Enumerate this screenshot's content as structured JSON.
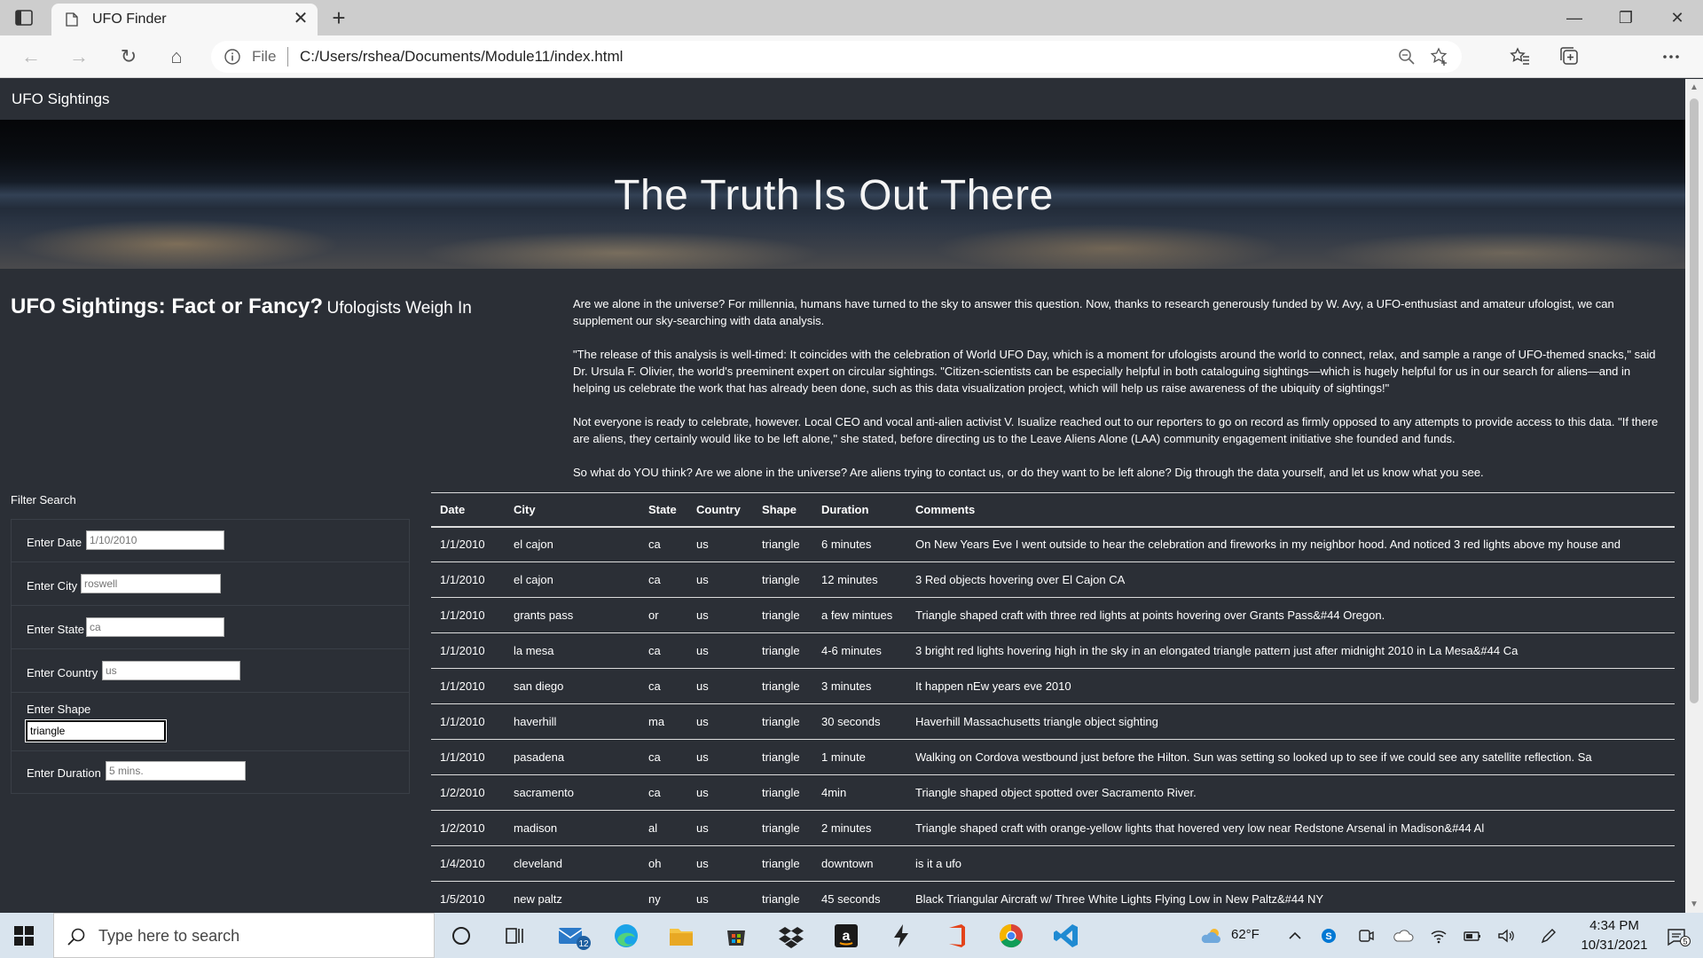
{
  "browser": {
    "tab_title": "UFO Finder",
    "address_prefix": "File",
    "url": "C:/Users/rshea/Documents/Module11/index.html"
  },
  "navbar": {
    "brand": "UFO Sightings"
  },
  "hero": {
    "title": "The Truth Is Out There"
  },
  "headline": {
    "main": "UFO Sightings: Fact or Fancy?",
    "sub": "Ufologists Weigh In"
  },
  "article": [
    "Are we alone in the universe? For millennia, humans have turned to the sky to answer this question. Now, thanks to research generously funded by W. Avy, a UFO-enthusiast and amateur ufologist, we can supplement our sky-searching with data analysis.",
    "\"The release of this analysis is well-timed: It coincides with the celebration of World UFO Day, which is a moment for ufologists around the world to connect, relax, and sample a range of UFO-themed snacks,\" said Dr. Ursula F. Olivier, the world's preeminent expert on circular sightings. \"Citizen-scientists can be especially helpful in both cataloguing sightings—which is hugely helpful for us in our search for aliens—and in helping us celebrate the work that has already been done, such as this data visualization project, which will help us raise awareness of the ubiquity of sightings!\"",
    "Not everyone is ready to celebrate, however. Local CEO and vocal anti-alien activist V. Isualize reached out to our reporters to go on record as firmly opposed to any attempts to provide access to this data. \"If there are aliens, they certainly would like to be left alone,\" she stated, before directing us to the Leave Aliens Alone (LAA) community engagement initiative she founded and funds.",
    "So what do YOU think? Are we alone in the universe? Are aliens trying to contact us, or do they want to be left alone? Dig through the data yourself, and let us know what you see."
  ],
  "filter": {
    "title": "Filter Search",
    "fields": [
      {
        "label": "Enter Date",
        "placeholder": "1/10/2010",
        "value": ""
      },
      {
        "label": "Enter City",
        "placeholder": "roswell",
        "value": ""
      },
      {
        "label": "Enter State",
        "placeholder": "ca",
        "value": ""
      },
      {
        "label": "Enter Country",
        "placeholder": "us",
        "value": ""
      },
      {
        "label": "Enter Shape",
        "placeholder": "",
        "value": "triangle"
      },
      {
        "label": "Enter Duration",
        "placeholder": "5 mins.",
        "value": ""
      }
    ]
  },
  "table": {
    "headers": [
      "Date",
      "City",
      "State",
      "Country",
      "Shape",
      "Duration",
      "Comments"
    ],
    "rows": [
      [
        "1/1/2010",
        "el cajon",
        "ca",
        "us",
        "triangle",
        "6 minutes",
        "On New Years Eve I went outside to hear the celebration and fireworks in my neighbor hood. And noticed 3 red lights above my house and"
      ],
      [
        "1/1/2010",
        "el cajon",
        "ca",
        "us",
        "triangle",
        "12 minutes",
        "3 Red objects hovering over El Cajon CA"
      ],
      [
        "1/1/2010",
        "grants pass",
        "or",
        "us",
        "triangle",
        "a few mintues",
        "Triangle shaped craft with three red lights at points hovering over Grants Pass&#44 Oregon."
      ],
      [
        "1/1/2010",
        "la mesa",
        "ca",
        "us",
        "triangle",
        "4-6 minutes",
        "3 bright red lights hovering high in the sky in an elongated triangle pattern just after midnight 2010 in La Mesa&#44 Ca"
      ],
      [
        "1/1/2010",
        "san diego",
        "ca",
        "us",
        "triangle",
        "3 minutes",
        "It happen nEw years eve 2010"
      ],
      [
        "1/1/2010",
        "haverhill",
        "ma",
        "us",
        "triangle",
        "30 seconds",
        "Haverhill Massachusetts triangle object sighting"
      ],
      [
        "1/1/2010",
        "pasadena",
        "ca",
        "us",
        "triangle",
        "1 minute",
        "Walking on Cordova westbound just before the Hilton. Sun was setting so looked up to see if we could see any satellite reflection. Sa"
      ],
      [
        "1/2/2010",
        "sacramento",
        "ca",
        "us",
        "triangle",
        "4min",
        "Triangle shaped object spotted over Sacramento River."
      ],
      [
        "1/2/2010",
        "madison",
        "al",
        "us",
        "triangle",
        "2 minutes",
        "Triangle shaped craft with orange-yellow lights that hovered very low near Redstone Arsenal in Madison&#44 Al"
      ],
      [
        "1/4/2010",
        "cleveland",
        "oh",
        "us",
        "triangle",
        "downtown",
        "is it a ufo"
      ],
      [
        "1/5/2010",
        "new paltz",
        "ny",
        "us",
        "triangle",
        "45 seconds",
        "Black Triangular Aircraft w/ Three White Lights Flying Low in New Paltz&#44 NY"
      ]
    ]
  },
  "taskbar": {
    "search_placeholder": "Type here to search",
    "mail_badge": "12",
    "weather": "62°F",
    "time": "4:34 PM",
    "date": "10/31/2021",
    "notifications": "5"
  }
}
